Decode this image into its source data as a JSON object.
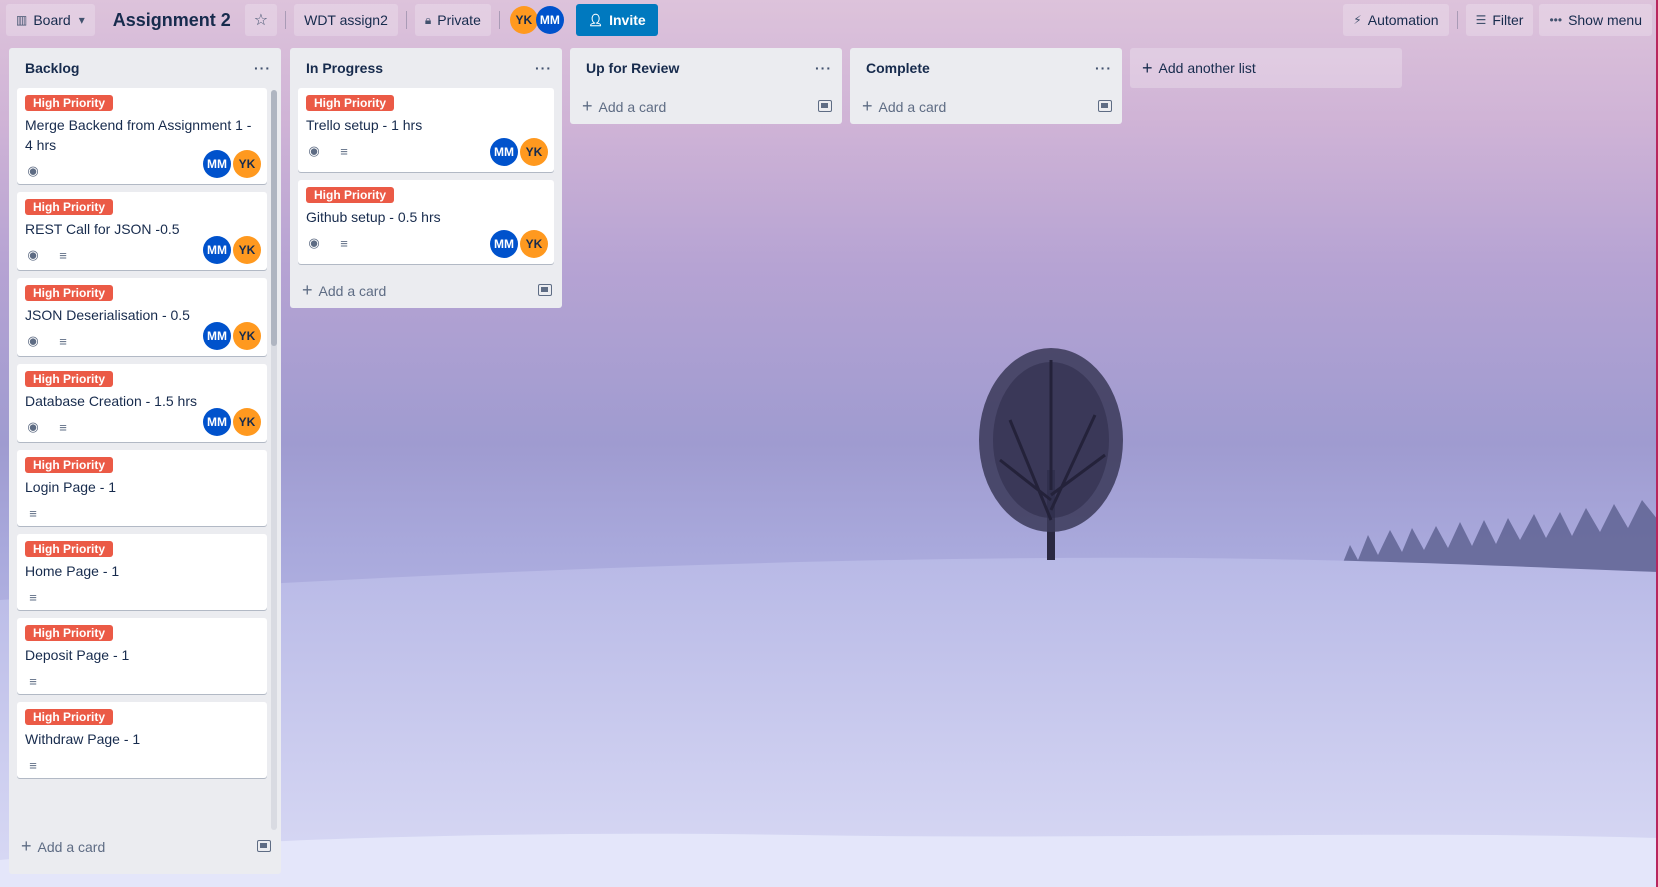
{
  "header": {
    "view_switcher": "Board",
    "board_title": "Assignment 2",
    "workspace": "WDT assign2",
    "visibility": "Private",
    "members": [
      "YK",
      "MM"
    ],
    "invite_label": "Invite",
    "automation_label": "Automation",
    "filter_label": "Filter",
    "show_menu_label": "Show menu"
  },
  "lists": [
    {
      "title": "Backlog",
      "add_card_label": "Add a card",
      "cards": [
        {
          "label": "High Priority",
          "title": "Merge Backend from Assignment 1 - 4 hrs",
          "watch": true,
          "description": false,
          "members": [
            "MM",
            "YK"
          ]
        },
        {
          "label": "High Priority",
          "title": "REST Call for JSON -0.5",
          "watch": true,
          "description": true,
          "members": [
            "MM",
            "YK"
          ]
        },
        {
          "label": "High Priority",
          "title": "JSON Deserialisation - 0.5",
          "watch": true,
          "description": true,
          "members": [
            "MM",
            "YK"
          ]
        },
        {
          "label": "High Priority",
          "title": "Database Creation - 1.5 hrs",
          "watch": true,
          "description": true,
          "members": [
            "MM",
            "YK"
          ]
        },
        {
          "label": "High Priority",
          "title": "Login Page - 1",
          "watch": false,
          "description": true,
          "members": []
        },
        {
          "label": "High Priority",
          "title": "Home Page - 1",
          "watch": false,
          "description": true,
          "members": []
        },
        {
          "label": "High Priority",
          "title": "Deposit Page - 1",
          "watch": false,
          "description": true,
          "members": []
        },
        {
          "label": "High Priority",
          "title": "Withdraw Page - 1",
          "watch": false,
          "description": true,
          "members": []
        }
      ]
    },
    {
      "title": "In Progress",
      "add_card_label": "Add a card",
      "cards": [
        {
          "label": "High Priority",
          "title": "Trello setup - 1 hrs",
          "watch": true,
          "description": true,
          "members": [
            "MM",
            "YK"
          ]
        },
        {
          "label": "High Priority",
          "title": "Github setup - 0.5 hrs",
          "watch": true,
          "description": true,
          "members": [
            "MM",
            "YK"
          ]
        }
      ]
    },
    {
      "title": "Up for Review",
      "add_card_label": "Add a card",
      "cards": []
    },
    {
      "title": "Complete",
      "add_card_label": "Add a card",
      "cards": []
    }
  ],
  "add_list_label": "Add another list",
  "colors": {
    "label_red": "#eb5a46",
    "invite_blue": "#0079bf",
    "avatar_mm": "#0052cc",
    "avatar_yk": "#ff991f",
    "list_bg": "#ebecf0"
  },
  "icons": {
    "view_switcher": "board-icon",
    "star": "star-icon",
    "private": "lock-icon",
    "invite": "add-user-icon",
    "automation": "lightning-icon",
    "filter": "filter-icon",
    "menu": "more-icon",
    "watch": "eye-icon",
    "description": "description-icon",
    "template": "template-icon"
  }
}
